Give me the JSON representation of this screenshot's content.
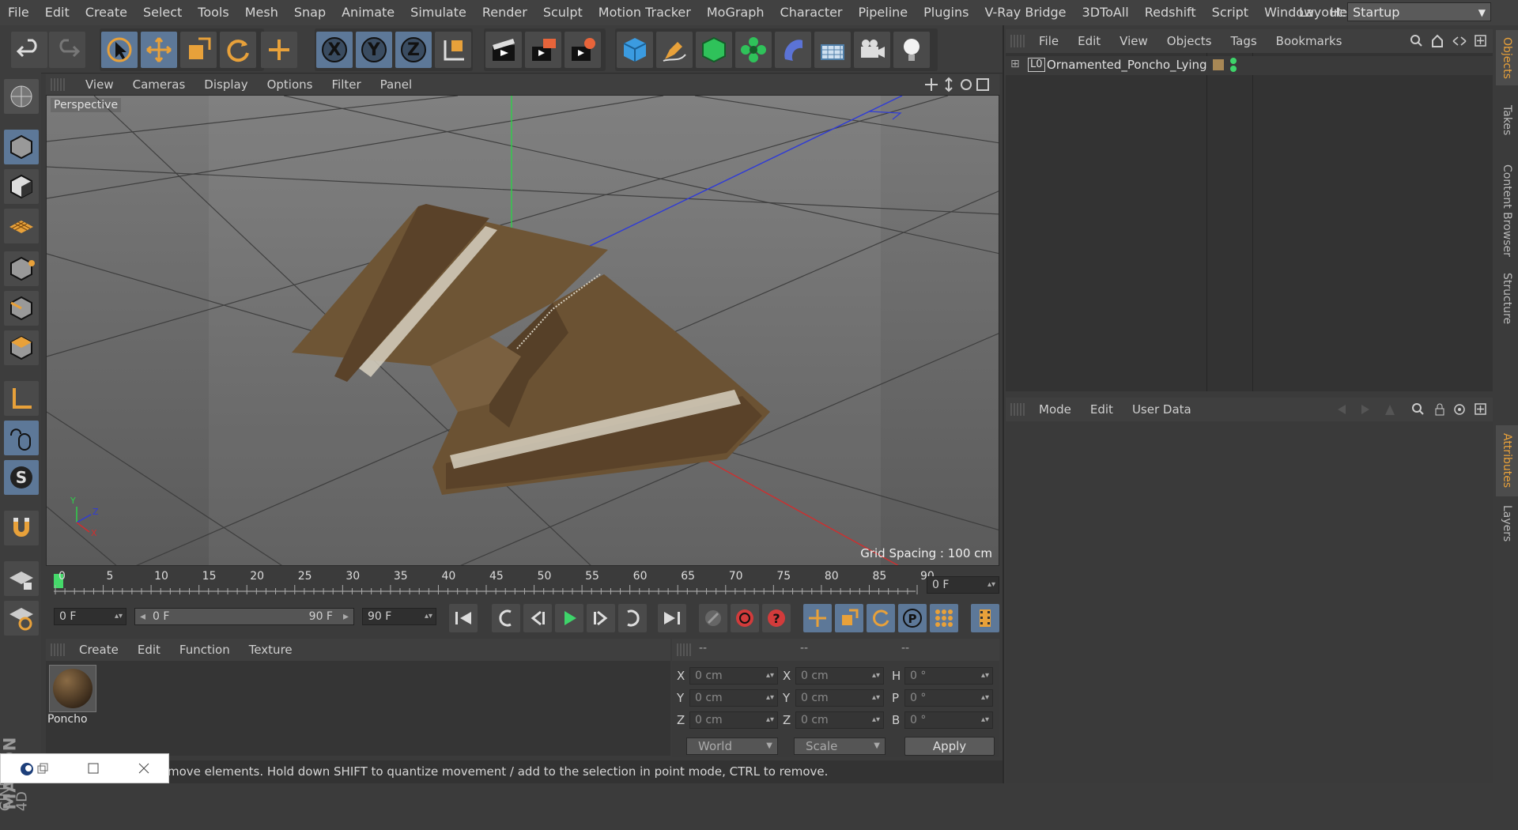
{
  "menubar": {
    "items": [
      "File",
      "Edit",
      "Create",
      "Select",
      "Tools",
      "Mesh",
      "Snap",
      "Animate",
      "Simulate",
      "Render",
      "Sculpt",
      "Motion Tracker",
      "MoGraph",
      "Character",
      "Pipeline",
      "Plugins",
      "V-Ray Bridge",
      "3DToAll",
      "Redshift",
      "Script",
      "Window",
      "Help"
    ],
    "layout_label": "Layout:",
    "layout_value": "Startup"
  },
  "toolbar": {
    "axis_x": "X",
    "axis_y": "Y",
    "axis_z": "Z"
  },
  "viewport": {
    "menus": [
      "View",
      "Cameras",
      "Display",
      "Options",
      "Filter",
      "Panel"
    ],
    "label": "Perspective",
    "grid_spacing": "Grid Spacing : 100 cm",
    "axis_y": "Y",
    "axis_z": "Z",
    "axis_x": "X"
  },
  "timeline": {
    "ticks": [
      "0",
      "5",
      "10",
      "15",
      "20",
      "25",
      "30",
      "35",
      "40",
      "45",
      "50",
      "55",
      "60",
      "65",
      "70",
      "75",
      "80",
      "85",
      "90"
    ],
    "current_frame": "0 F",
    "start_frame": "0 F",
    "range_start": "0 F",
    "range_end": "90 F",
    "end_frame": "90 F"
  },
  "material_manager": {
    "menus": [
      "Create",
      "Edit",
      "Function",
      "Texture"
    ],
    "material_name": "Poncho"
  },
  "coordinates": {
    "headers": [
      "--",
      "--",
      "--"
    ],
    "row_labels_left": [
      "X",
      "Y",
      "Z"
    ],
    "row_labels_mid": [
      "X",
      "Y",
      "Z"
    ],
    "row_labels_right": [
      "H",
      "P",
      "B"
    ],
    "pos": [
      "0 cm",
      "0 cm",
      "0 cm"
    ],
    "size": [
      "0 cm",
      "0 cm",
      "0 cm"
    ],
    "rot": [
      "0 °",
      "0 °",
      "0 °"
    ],
    "coord_mode": "World",
    "size_mode": "Scale",
    "apply": "Apply"
  },
  "object_manager": {
    "menus": [
      "File",
      "Edit",
      "View",
      "Objects",
      "Tags",
      "Bookmarks"
    ],
    "object_name": "Ornamented_Poncho_Lying",
    "layer_glyph": "L0"
  },
  "attribute_manager": {
    "menus": [
      "Mode",
      "Edit",
      "User Data"
    ]
  },
  "right_tabs": [
    "Objects",
    "Takes",
    "Content Browser",
    "Structure"
  ],
  "right_tabs_lower": [
    "Attributes",
    "Layers"
  ],
  "statusbar": {
    "text": "move elements. Hold down SHIFT to quantize movement / add to the selection in point mode, CTRL to remove."
  },
  "logo": {
    "brand1": "MAXON",
    "brand2": "CINEMA 4D"
  },
  "colors": {
    "accent": "#e8a13a",
    "active_tool": "#5d7898",
    "cloth": "#6e5535",
    "green_frame": "#45d96a"
  }
}
